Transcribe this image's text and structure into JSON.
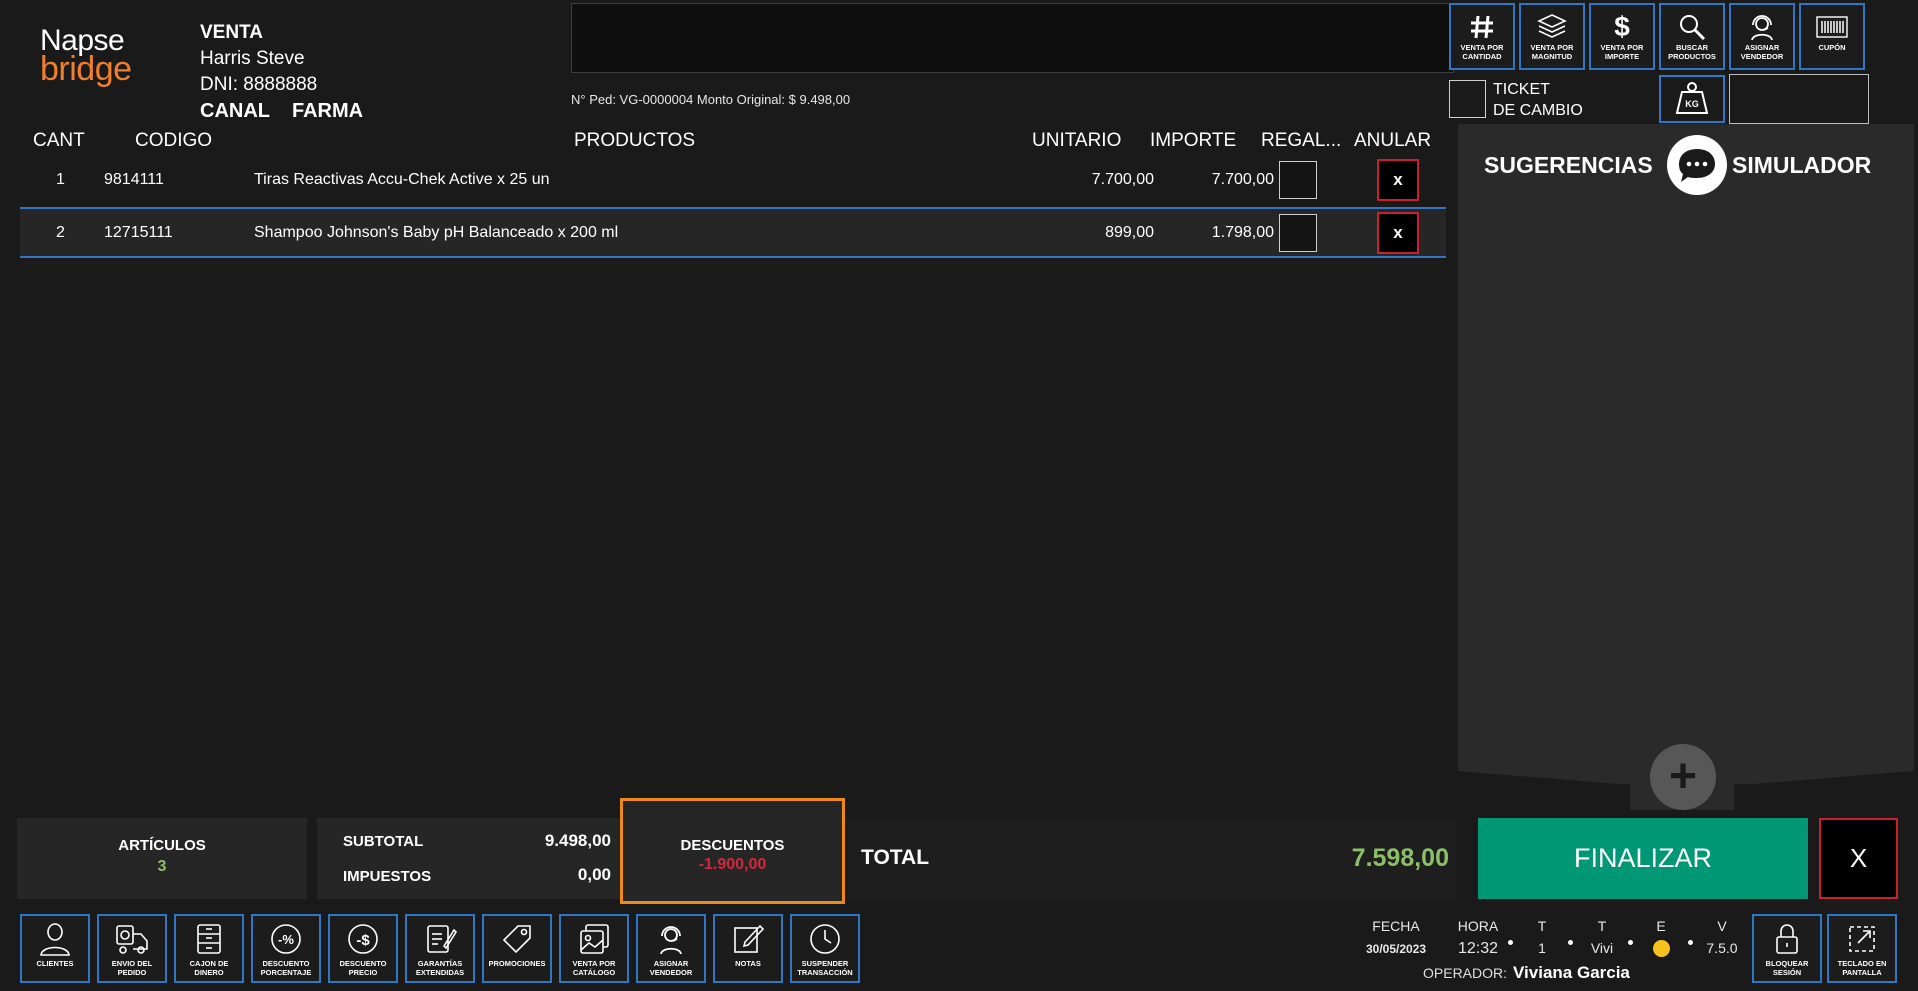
{
  "logo": {
    "top": "Napse",
    "bottom": "bridge"
  },
  "sale": {
    "title": "VENTA",
    "customer": "Harris Steve",
    "dni": "DNI: 8888888",
    "canal_label": "CANAL",
    "canal_value": "FARMA"
  },
  "order": {
    "line": "N° Ped: VG-0000004  Monto Original: $ 9.498,00"
  },
  "toolbar": [
    {
      "label": "VENTA POR\nCANTIDAD",
      "icon": "hash-icon"
    },
    {
      "label": "VENTA POR\nMAGNITUD",
      "icon": "layers-icon"
    },
    {
      "label": "VENTA POR\nIMPORTE",
      "icon": "dollar-icon"
    },
    {
      "label": "BUSCAR\nPRODUCTOS",
      "icon": "search-icon"
    },
    {
      "label": "ASIGNAR\nVENDEDOR",
      "icon": "headset-icon"
    },
    {
      "label": "CUPÓN",
      "icon": "barcode-icon"
    }
  ],
  "ticket": {
    "line1": "TICKET",
    "line2": "DE CAMBIO"
  },
  "kg": {
    "label": "KG"
  },
  "table": {
    "headers": [
      "CANT",
      "CODIGO",
      "PRODUCTOS",
      "UNITARIO",
      "IMPORTE",
      "REGAL...",
      "ANULAR"
    ],
    "rows": [
      {
        "cant": "1",
        "codigo": "9814111",
        "producto": "Tiras Reactivas Accu-Chek Active x 25 un",
        "unitario": "7.700,00",
        "importe": "7.700,00",
        "anular": "x"
      },
      {
        "cant": "2",
        "codigo": "12715111",
        "producto": "Shampoo Johnson's Baby pH Balanceado x 200 ml",
        "unitario": "899,00",
        "importe": "1.798,00",
        "anular": "x"
      }
    ]
  },
  "suggestions": {
    "left": "SUGERENCIAS",
    "right": "SIMULADOR"
  },
  "totals": {
    "articulos_label": "ARTÍCULOS",
    "articulos_value": "3",
    "subtotal_label": "SUBTOTAL",
    "subtotal_value": "9.498,00",
    "impuestos_label": "IMPUESTOS",
    "impuestos_value": "0,00",
    "descuentos_label": "DESCUENTOS",
    "descuentos_value": "-1.900,00",
    "total_label": "TOTAL",
    "total_value": "7.598,00"
  },
  "actions": {
    "finalizar": "FINALIZAR",
    "cancel": "X",
    "plus": "+"
  },
  "bottom_toolbar": [
    {
      "label": "CLIENTES",
      "icon": "user-icon"
    },
    {
      "label": "ENVIO DEL\nPEDIDO",
      "icon": "truck-icon"
    },
    {
      "label": "CAJON DE\nDINERO",
      "icon": "drawer-icon"
    },
    {
      "label": "DESCUENTO\nPORCENTAJE",
      "icon": "percent-icon"
    },
    {
      "label": "DESCUENTO\nPRECIO",
      "icon": "dollar-circle-icon"
    },
    {
      "label": "GARANTÍAS\nEXTENDIDAS",
      "icon": "certificate-icon"
    },
    {
      "label": "PROMOCIONES",
      "icon": "tag-icon"
    },
    {
      "label": "VENTA POR\nCATÁLOGO",
      "icon": "catalog-icon"
    },
    {
      "label": "ASIGNAR\nVENDEDOR",
      "icon": "headset-icon"
    },
    {
      "label": "NOTAS",
      "icon": "notes-icon"
    },
    {
      "label": "SUSPENDER\nTRANSACCIÓN",
      "icon": "clock-icon"
    }
  ],
  "status": {
    "fecha_label": "FECHA",
    "fecha_value": "30/05/2023",
    "hora_label": "HORA",
    "hora_value": "12:32",
    "t1_label": "T",
    "t1_value": "1",
    "t2_label": "T",
    "t2_value": "Vivi",
    "e_label": "E",
    "v_label": "V",
    "v_value": "7.5.0",
    "status_color": "#f6c21b",
    "operador_label": "OPERADOR:",
    "operador_value": "Viviana Garcia"
  },
  "right_buttons": [
    {
      "label": "BLOQUEAR\nSESIÓN",
      "icon": "lock-icon"
    },
    {
      "label": "TECLADO EN\nPANTALLA",
      "icon": "expand-icon"
    }
  ]
}
